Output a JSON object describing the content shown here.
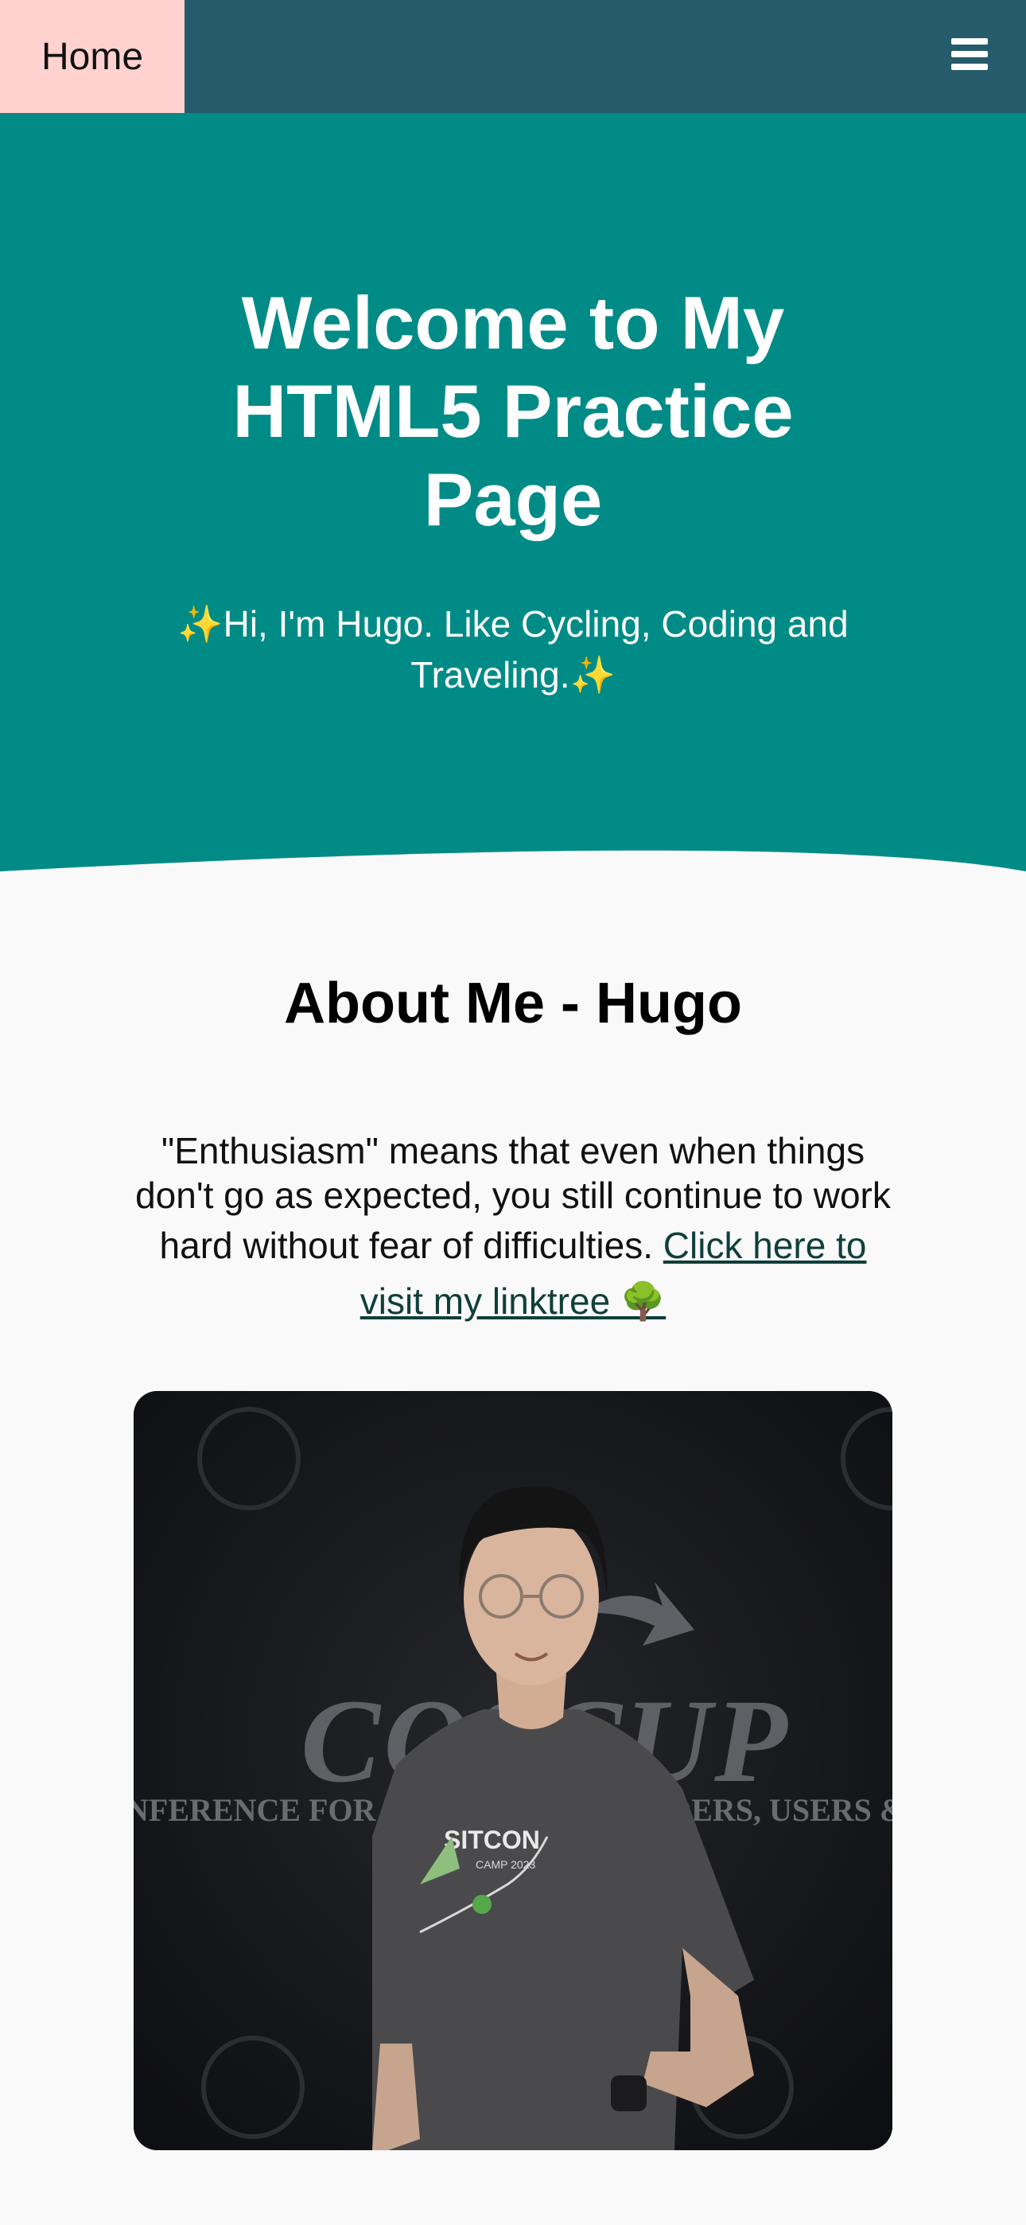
{
  "nav": {
    "home_label": "Home",
    "menu_icon": "hamburger-menu-icon"
  },
  "hero": {
    "title": "Welcome to My HTML5 Practice Page",
    "subtitle": "✨Hi, I'm Hugo. Like Cycling, Coding and Traveling.✨"
  },
  "about": {
    "title": "About Me - Hugo",
    "quote": "\"Enthusiasm\" means that even when things don't go as expected, you still continue to work hard without fear of difficulties. ",
    "link_text": "Click here to visit my linktree 🌳"
  },
  "photo": {
    "banner_text_large": "COSCUP",
    "banner_text_small": "CONFERENCE FOR OPEN SOURCE CODERS, USERS & PROMOTERS",
    "shirt_text": "SITCON",
    "shirt_subtext": "CAMP 2023"
  },
  "colors": {
    "topbar": "#255b6b",
    "home_button": "#ffd2cf",
    "hero": "#008b87",
    "page_background": "#f9f9f9",
    "link": "#0f3f3a"
  }
}
